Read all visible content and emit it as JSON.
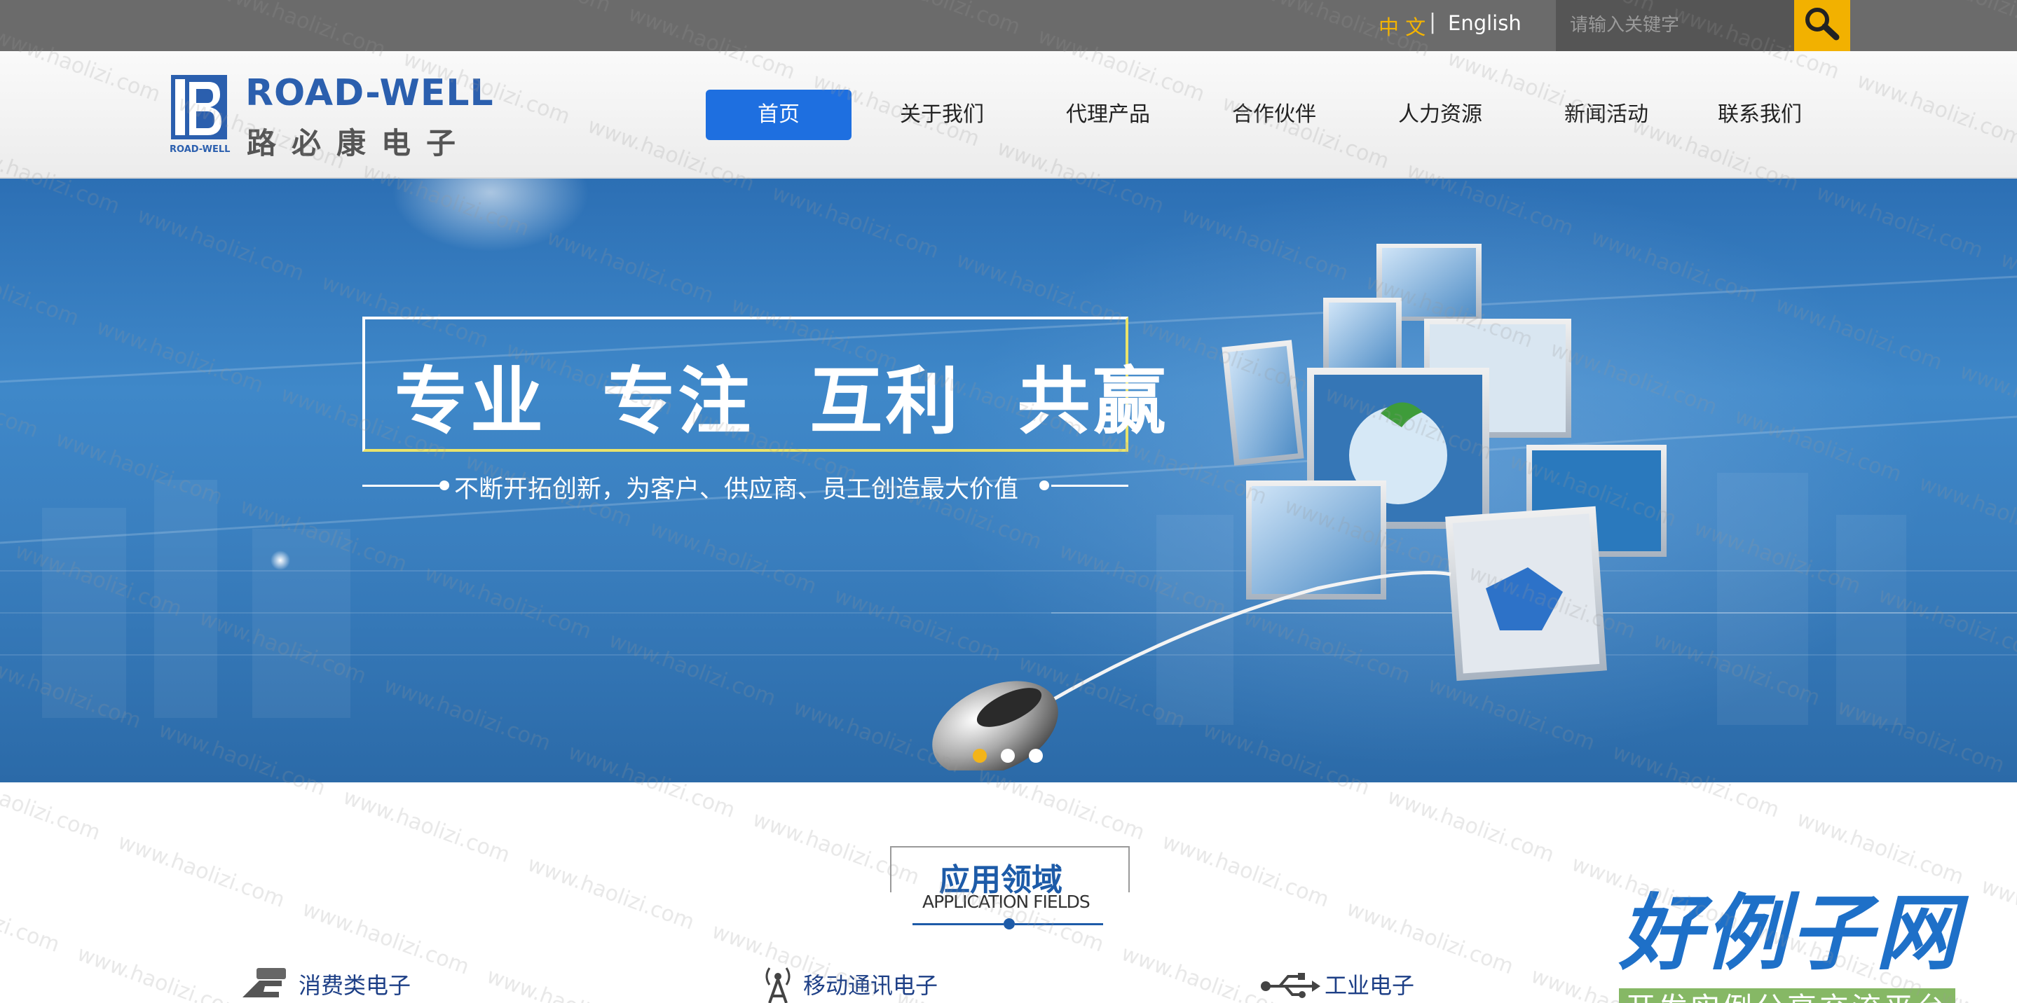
{
  "topbar": {
    "lang_cn": "中 文",
    "lang_separator": "|",
    "lang_en": "English",
    "search_placeholder": "请输入关键字",
    "search_icon": "search-icon"
  },
  "logo": {
    "en": "ROAD-WELL",
    "cn": "路必康电子",
    "mark_caption": "ROAD-WELL"
  },
  "nav": {
    "items": [
      {
        "label": "首页",
        "active": true
      },
      {
        "label": "关于我们",
        "active": false
      },
      {
        "label": "代理产品",
        "active": false
      },
      {
        "label": "合作伙伴",
        "active": false
      },
      {
        "label": "人力资源",
        "active": false
      },
      {
        "label": "新闻活动",
        "active": false
      },
      {
        "label": "联系我们",
        "active": false
      }
    ]
  },
  "banner": {
    "slogan": "专业 专注 互利 共赢",
    "tagline": "不断开拓创新，为客户、供应商、员工创造最大价值",
    "slides": 3,
    "active_slide": 1
  },
  "application_fields": {
    "title_cn": "应用领域",
    "title_en": "APPLICATION FIELDS",
    "items": [
      {
        "label": "消费类电子",
        "icon": "hand-device-icon"
      },
      {
        "label": "移动通讯电子",
        "icon": "antenna-icon"
      },
      {
        "label": "工业电子",
        "icon": "usb-icon"
      }
    ]
  },
  "watermark": {
    "site_logo": "好例子网",
    "site_sub": "开发实例分享交流平台",
    "repeat_text": "www.haolizi.com"
  },
  "colors": {
    "accent_blue": "#1e6fe0",
    "brand_blue": "#2b5fae",
    "highlight_yellow": "#f2b100",
    "topbar_gray": "#6b6b6b"
  }
}
